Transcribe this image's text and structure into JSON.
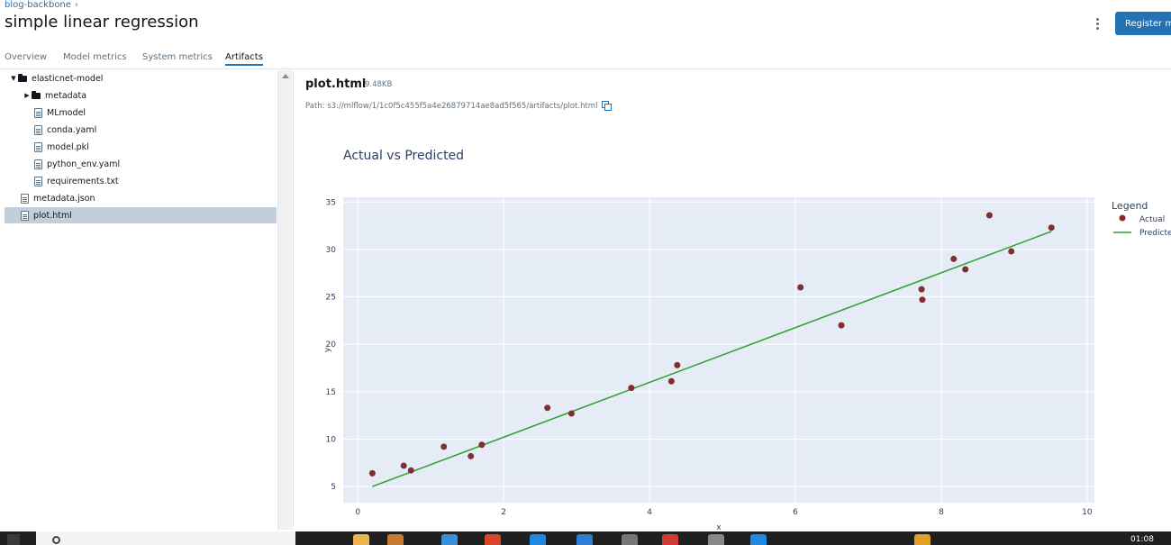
{
  "header": {
    "breadcrumb": "blog-backbone",
    "breadcrumb_separator": "›",
    "title": "simple linear regression",
    "register_button": "Register mo"
  },
  "tabs": [
    {
      "label": "Overview",
      "active": false
    },
    {
      "label": "Model metrics",
      "active": false
    },
    {
      "label": "System metrics",
      "active": false
    },
    {
      "label": "Artifacts",
      "active": true
    }
  ],
  "tree": {
    "root_folder": "elasticnet-model",
    "metadata_folder": "metadata",
    "files": [
      "MLmodel",
      "conda.yaml",
      "model.pkl",
      "python_env.yaml",
      "requirements.txt"
    ],
    "root_files": [
      "metadata.json",
      "plot.html"
    ],
    "selected": "plot.html"
  },
  "viewer": {
    "file_name": "plot.html",
    "file_size": "9.48KB",
    "path_label": "Path:",
    "path_value": "s3://mlflow/1/1c0f5c455f5a4e26879714ae8ad5f565/artifacts/plot.html"
  },
  "chart_data": {
    "type": "scatter",
    "title": "Actual vs Predicted",
    "xlabel": "x",
    "ylabel": "y",
    "xlim": [
      -0.2,
      10.1
    ],
    "ylim": [
      3.3,
      35.5
    ],
    "xticks": [
      0,
      2,
      4,
      6,
      8,
      10
    ],
    "yticks": [
      5,
      10,
      15,
      20,
      25,
      30,
      35
    ],
    "grid": true,
    "legend_title": "Legend",
    "legend_position": "right",
    "series": [
      {
        "name": "Actual",
        "mode": "markers",
        "color": "#7f2f30",
        "x": [
          0.2,
          0.63,
          0.73,
          1.18,
          1.55,
          1.7,
          2.6,
          2.93,
          3.75,
          4.3,
          4.38,
          6.07,
          6.63,
          7.73,
          7.74,
          8.17,
          8.33,
          8.66,
          8.96,
          9.51
        ],
        "y": [
          6.4,
          7.2,
          6.7,
          9.2,
          8.2,
          9.4,
          13.3,
          12.7,
          15.4,
          16.1,
          17.8,
          26.0,
          22.0,
          25.8,
          24.7,
          29.0,
          27.9,
          33.6,
          29.8,
          32.3
        ]
      },
      {
        "name": "Predicted",
        "mode": "lines",
        "color": "#2ca02c",
        "x": [
          0.2,
          9.51
        ],
        "y": [
          5.0,
          31.9
        ]
      }
    ]
  },
  "taskbar": {
    "clock": "01:08"
  }
}
